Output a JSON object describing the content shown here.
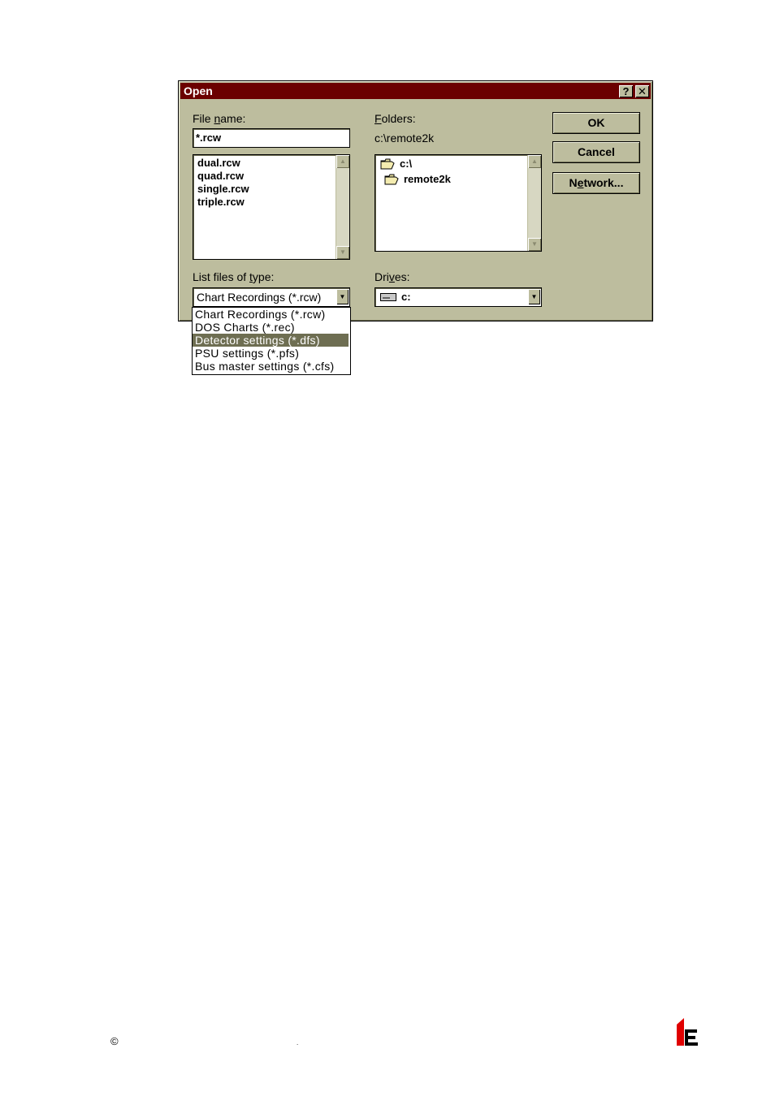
{
  "dialog": {
    "title": "Open",
    "help_label": "?",
    "close_label": "✕"
  },
  "file_name": {
    "label_pre": "File ",
    "label_u": "n",
    "label_post": "ame:",
    "value": "*.rcw",
    "files": [
      "dual.rcw",
      "quad.rcw",
      "single.rcw",
      "triple.rcw"
    ]
  },
  "folders": {
    "label_u": "F",
    "label_post": "olders:",
    "path": "c:\\remote2k",
    "items": [
      "c:\\",
      "remote2k"
    ]
  },
  "buttons": {
    "ok": "OK",
    "cancel": "Cancel",
    "network_pre": "N",
    "network_u": "e",
    "network_post": "twork..."
  },
  "file_type": {
    "label_pre": "List files of ",
    "label_u": "t",
    "label_post": "ype:",
    "selected": "Chart Recordings (*.rcw)",
    "options": [
      "Chart Recordings (*.rcw)",
      "DOS Charts (*.rec)",
      "Detector settings (*.dfs)",
      "PSU settings (*.pfs)",
      "Bus master settings (*.cfs)"
    ],
    "highlighted_index": 2
  },
  "drives": {
    "label_pre": "Dri",
    "label_u": "v",
    "label_post": "es:",
    "selected": "c:"
  },
  "footer": {
    "copyright": "©",
    "dot": "."
  },
  "colors": {
    "title_bar": "#6b0000",
    "dialog_face": "#bdbd9e",
    "highlight": "#6e6e52",
    "logo_red": "#e00000"
  }
}
